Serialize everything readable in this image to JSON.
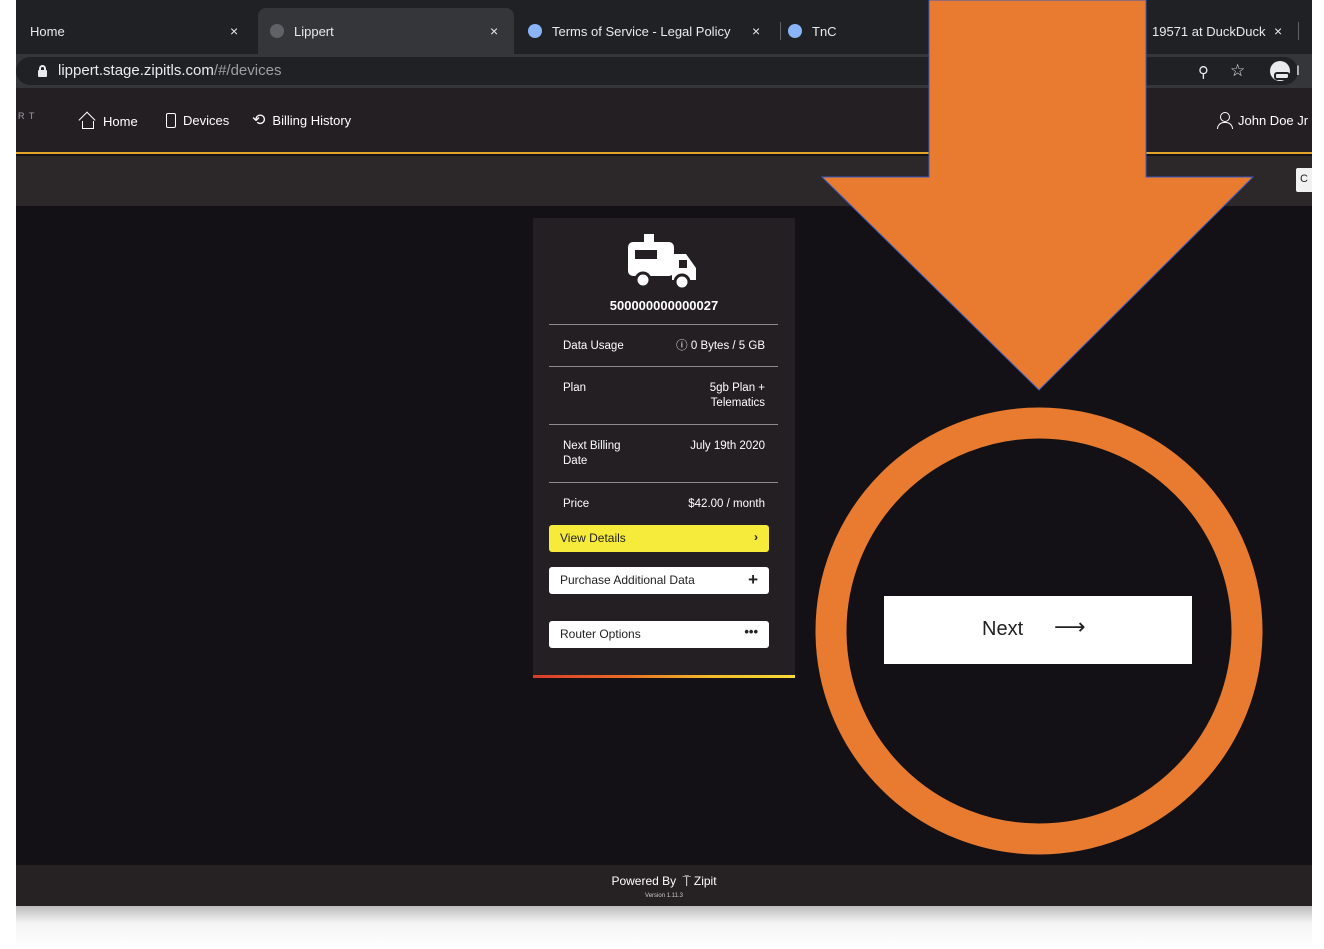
{
  "browser": {
    "tabs": [
      {
        "title": "Home",
        "close": "×"
      },
      {
        "title": "Lippert",
        "close": "×"
      },
      {
        "title": "Terms of Service - Legal Policy",
        "close": "×"
      },
      {
        "title": "TnC"
      },
      {
        "title": "19571 at DuckDuck",
        "close": "×"
      }
    ],
    "url_host": "lippert.stage.zipitls.com",
    "url_path": "/#/devices",
    "zoom_icon": "⚲",
    "star_icon": "☆",
    "incognito_label": "I"
  },
  "nav": {
    "brand": "R T",
    "items": [
      {
        "label": "Home",
        "icon": "home-icon"
      },
      {
        "label": "Devices",
        "icon": "device-icon"
      },
      {
        "label": "Billing History",
        "icon": "history-icon"
      }
    ],
    "history_glyph": "⟲",
    "user": "John Doe Jr",
    "subbar_button": "C"
  },
  "device": {
    "id": "500000000000027",
    "rows": [
      {
        "key": "Data Usage",
        "value": "ⓘ 0 Bytes / 5 GB"
      },
      {
        "key": "Plan",
        "value_lines": [
          "5gb Plan +",
          "Telematics"
        ]
      },
      {
        "key_lines": [
          "Next Billing",
          "Date"
        ],
        "value": "July 19th 2020"
      },
      {
        "key": "Price",
        "value": "$42.00 / month"
      }
    ],
    "buttons": {
      "view_details": {
        "label": "View Details",
        "icon": "›"
      },
      "purchase_data": {
        "label": "Purchase Additional Data",
        "icon": "+"
      },
      "router_options": {
        "label": "Router Options",
        "icon": "•••"
      }
    }
  },
  "footer": {
    "powered_by": "Powered By",
    "zipit_mark": "⍑",
    "zipit": "Zipit",
    "version": "Version 1.11.3"
  },
  "annotation": {
    "next_label": "Next",
    "next_arrow": "⟶",
    "colors": {
      "arrow": "#e87b30",
      "arrow_outline": "#3a5bbf",
      "circle": "#e87b30"
    }
  }
}
